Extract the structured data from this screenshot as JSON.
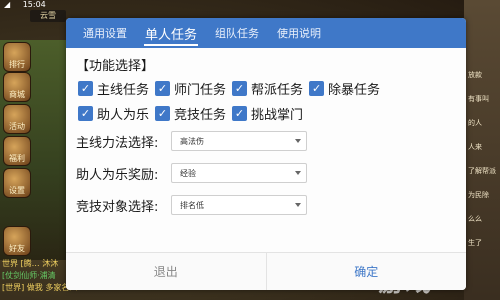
{
  "status_bar": {
    "signal": "◢",
    "time": "15:04"
  },
  "game": {
    "title": "云雪",
    "side_buttons": [
      {
        "label": "排行",
        "name": "rank"
      },
      {
        "label": "商城",
        "name": "shop"
      },
      {
        "label": "活动",
        "name": "event"
      },
      {
        "label": "福利",
        "name": "welfare"
      },
      {
        "label": "设置",
        "name": "settings"
      },
      {
        "label": "好友",
        "name": "friends"
      }
    ],
    "chat": [
      {
        "text": "世界 [腾… 沐沐",
        "color": "#f0d060"
      },
      {
        "text": "[仗剑仙师·浦清",
        "color": "#66cc66"
      },
      {
        "text": "[世界] 做我 多家名人",
        "color": "#f0d060"
      }
    ],
    "right_hints": [
      "放款",
      "有事叫",
      "的人",
      "人来",
      "了解帮派",
      "为民除",
      "么么",
      "生了"
    ],
    "watermark": "游戏"
  },
  "dialog": {
    "tabs": [
      {
        "label": "通用设置",
        "active": false
      },
      {
        "label": "单人任务",
        "active": true
      },
      {
        "label": "组队任务",
        "active": false
      },
      {
        "label": "使用说明",
        "active": false
      }
    ],
    "section_title": "【功能选择】",
    "checkboxes": [
      [
        {
          "label": "主线任务",
          "checked": true
        },
        {
          "label": "师门任务",
          "checked": true
        },
        {
          "label": "帮派任务",
          "checked": true
        },
        {
          "label": "除暴任务",
          "checked": true
        }
      ],
      [
        {
          "label": "助人为乐",
          "checked": true
        },
        {
          "label": "竞技任务",
          "checked": true
        },
        {
          "label": "挑战掌门",
          "checked": true
        }
      ]
    ],
    "selects": [
      {
        "label": "主线力法选择:",
        "value": "高法伤"
      },
      {
        "label": "助人为乐奖励:",
        "value": "经验"
      },
      {
        "label": "竞技对象选择:",
        "value": "排名低"
      }
    ],
    "footer": {
      "cancel": "退出",
      "confirm": "确定"
    }
  },
  "colors": {
    "accent": "#3f78c8"
  }
}
